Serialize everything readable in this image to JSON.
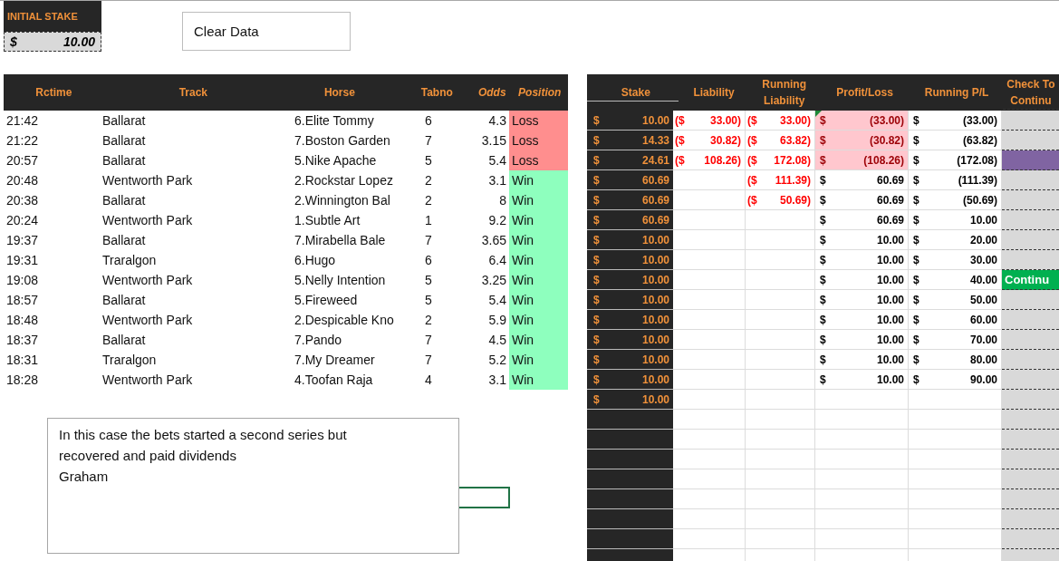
{
  "initial_stake": {
    "label": "INITIAL STAKE",
    "currency": "$",
    "value": "10.00"
  },
  "clear_button": "Clear Data",
  "left_table": {
    "columns": [
      {
        "label": "Rctime",
        "italic": false
      },
      {
        "label": "Track",
        "italic": false
      },
      {
        "label": "Horse",
        "italic": false
      },
      {
        "label": "Tabno",
        "italic": false
      },
      {
        "label": "Odds",
        "italic": true
      },
      {
        "label": "Position",
        "italic": true
      }
    ],
    "rows": [
      {
        "time": "21:42",
        "track": "Ballarat",
        "horse": "6.Elite Tommy",
        "tabno": "6",
        "odds": "4.3",
        "position": "Loss",
        "kind": "loss"
      },
      {
        "time": "21:22",
        "track": "Ballarat",
        "horse": "7.Boston Garden",
        "tabno": "7",
        "odds": "3.15",
        "position": "Loss",
        "kind": "loss"
      },
      {
        "time": "20:57",
        "track": "Ballarat",
        "horse": "5.Nike Apache",
        "tabno": "5",
        "odds": "5.4",
        "position": "Loss",
        "kind": "loss"
      },
      {
        "time": "20:48",
        "track": "Wentworth Park",
        "horse": "2.Rockstar Lopez",
        "tabno": "2",
        "odds": "3.1",
        "position": "Win",
        "kind": "win"
      },
      {
        "time": "20:38",
        "track": "Ballarat",
        "horse": "2.Winnington Bal",
        "tabno": "2",
        "odds": "8",
        "position": "Win",
        "kind": "win"
      },
      {
        "time": "20:24",
        "track": "Wentworth Park",
        "horse": "1.Subtle Art",
        "tabno": "1",
        "odds": "9.2",
        "position": "Win",
        "kind": "win"
      },
      {
        "time": "19:37",
        "track": "Ballarat",
        "horse": "7.Mirabella Bale",
        "tabno": "7",
        "odds": "3.65",
        "position": "Win",
        "kind": "win"
      },
      {
        "time": "19:31",
        "track": "Traralgon",
        "horse": "6.Hugo",
        "tabno": "6",
        "odds": "6.4",
        "position": "Win",
        "kind": "win"
      },
      {
        "time": "19:08",
        "track": "Wentworth Park",
        "horse": "5.Nelly Intention",
        "tabno": "5",
        "odds": "3.25",
        "position": "Win",
        "kind": "win"
      },
      {
        "time": "18:57",
        "track": "Ballarat",
        "horse": "5.Fireweed",
        "tabno": "5",
        "odds": "5.4",
        "position": "Win",
        "kind": "win"
      },
      {
        "time": "18:48",
        "track": "Wentworth Park",
        "horse": "2.Despicable Kno",
        "tabno": "2",
        "odds": "5.9",
        "position": "Win",
        "kind": "win"
      },
      {
        "time": "18:37",
        "track": "Ballarat",
        "horse": "7.Pando",
        "tabno": "7",
        "odds": "4.5",
        "position": "Win",
        "kind": "win"
      },
      {
        "time": "18:31",
        "track": "Traralgon",
        "horse": "7.My Dreamer",
        "tabno": "7",
        "odds": "5.2",
        "position": "Win",
        "kind": "win"
      },
      {
        "time": "18:28",
        "track": "Wentworth Park",
        "horse": "4.Toofan Raja",
        "tabno": "4",
        "odds": "3.1",
        "position": "Win",
        "kind": "win"
      }
    ]
  },
  "note": {
    "lines": [
      "In this case the bets started a second series but recovered and paid dividends",
      "Graham"
    ]
  },
  "right_table": {
    "columns": [
      "Stake",
      "Liability",
      "Running Liability",
      "Profit/Loss",
      "Running P/L",
      "Check To Continu"
    ],
    "rows": [
      {
        "stake": [
          "$",
          "10.00"
        ],
        "liability": [
          "($",
          "33.00)"
        ],
        "running_liability": [
          "($",
          "33.00)"
        ],
        "profit_loss": [
          "$",
          "(33.00)"
        ],
        "running_pl": [
          "$",
          "(33.00)"
        ],
        "loss": true,
        "comment": true,
        "check": {
          "kind": "empty"
        }
      },
      {
        "stake": [
          "$",
          "14.33"
        ],
        "liability": [
          "($",
          "30.82)"
        ],
        "running_liability": [
          "($",
          "63.82)"
        ],
        "profit_loss": [
          "$",
          "(30.82)"
        ],
        "running_pl": [
          "$",
          "(63.82)"
        ],
        "loss": true,
        "comment": false,
        "check": {
          "kind": "empty"
        }
      },
      {
        "stake": [
          "$",
          "24.61"
        ],
        "liability": [
          "($",
          "108.26)"
        ],
        "running_liability": [
          "($",
          "172.08)"
        ],
        "profit_loss": [
          "$",
          "(108.26)"
        ],
        "running_pl": [
          "$",
          "(172.08)"
        ],
        "loss": true,
        "comment": false,
        "check": {
          "kind": "alert"
        }
      },
      {
        "stake": [
          "$",
          "60.69"
        ],
        "running_liability": [
          "($",
          "111.39)"
        ],
        "profit_loss": [
          "$",
          "60.69"
        ],
        "running_pl": [
          "$",
          "(111.39)"
        ],
        "loss": false,
        "comment": false,
        "check": {
          "kind": "empty"
        }
      },
      {
        "stake": [
          "$",
          "60.69"
        ],
        "running_liability": [
          "($",
          "50.69)"
        ],
        "profit_loss": [
          "$",
          "60.69"
        ],
        "running_pl": [
          "$",
          "(50.69)"
        ],
        "loss": false,
        "comment": false,
        "check": {
          "kind": "empty"
        }
      },
      {
        "stake": [
          "$",
          "60.69"
        ],
        "profit_loss": [
          "$",
          "60.69"
        ],
        "running_pl": [
          "$",
          "10.00"
        ],
        "loss": false,
        "comment": false,
        "check": {
          "kind": "empty"
        }
      },
      {
        "stake": [
          "$",
          "10.00"
        ],
        "profit_loss": [
          "$",
          "10.00"
        ],
        "running_pl": [
          "$",
          "20.00"
        ],
        "loss": false,
        "comment": false,
        "check": {
          "kind": "empty"
        }
      },
      {
        "stake": [
          "$",
          "10.00"
        ],
        "profit_loss": [
          "$",
          "10.00"
        ],
        "running_pl": [
          "$",
          "30.00"
        ],
        "loss": false,
        "comment": false,
        "check": {
          "kind": "empty"
        }
      },
      {
        "stake": [
          "$",
          "10.00"
        ],
        "profit_loss": [
          "$",
          "10.00"
        ],
        "running_pl": [
          "$",
          "40.00"
        ],
        "loss": false,
        "comment": false,
        "check": {
          "kind": "continue",
          "label": "Continu"
        }
      },
      {
        "stake": [
          "$",
          "10.00"
        ],
        "profit_loss": [
          "$",
          "10.00"
        ],
        "running_pl": [
          "$",
          "50.00"
        ],
        "loss": false,
        "comment": false,
        "check": {
          "kind": "empty"
        }
      },
      {
        "stake": [
          "$",
          "10.00"
        ],
        "profit_loss": [
          "$",
          "10.00"
        ],
        "running_pl": [
          "$",
          "60.00"
        ],
        "loss": false,
        "comment": false,
        "check": {
          "kind": "empty"
        }
      },
      {
        "stake": [
          "$",
          "10.00"
        ],
        "profit_loss": [
          "$",
          "10.00"
        ],
        "running_pl": [
          "$",
          "70.00"
        ],
        "loss": false,
        "comment": false,
        "check": {
          "kind": "empty"
        }
      },
      {
        "stake": [
          "$",
          "10.00"
        ],
        "profit_loss": [
          "$",
          "10.00"
        ],
        "running_pl": [
          "$",
          "80.00"
        ],
        "loss": false,
        "comment": false,
        "check": {
          "kind": "empty"
        }
      },
      {
        "stake": [
          "$",
          "10.00"
        ],
        "profit_loss": [
          "$",
          "10.00"
        ],
        "running_pl": [
          "$",
          "90.00"
        ],
        "loss": false,
        "comment": false,
        "check": {
          "kind": "empty"
        }
      },
      {
        "stake": [
          "$",
          "10.00"
        ],
        "loss": false,
        "comment": false,
        "check": {
          "kind": "empty"
        }
      }
    ]
  }
}
